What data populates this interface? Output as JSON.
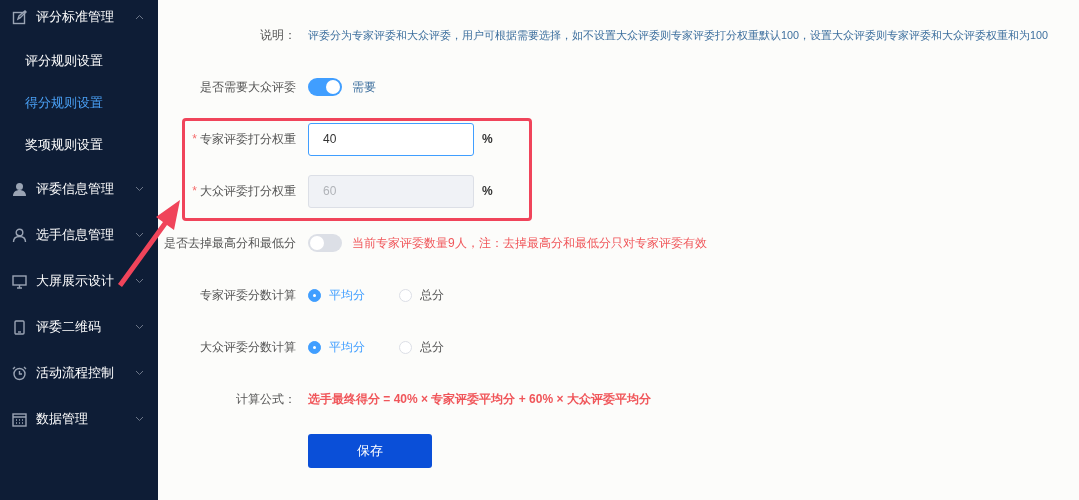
{
  "sidebar": {
    "items": [
      {
        "label": "评分标准管理",
        "expanded": true,
        "children": [
          {
            "label": "评分规则设置",
            "selected": false
          },
          {
            "label": "得分规则设置",
            "selected": true
          },
          {
            "label": "奖项规则设置",
            "selected": false
          }
        ]
      },
      {
        "label": "评委信息管理",
        "expanded": false
      },
      {
        "label": "选手信息管理",
        "expanded": false
      },
      {
        "label": "大屏展示设计",
        "expanded": false
      },
      {
        "label": "评委二维码",
        "expanded": false
      },
      {
        "label": "活动流程控制",
        "expanded": false
      },
      {
        "label": "数据管理",
        "expanded": false
      }
    ]
  },
  "form": {
    "rows": [
      {
        "kind": "note",
        "label": "说明：",
        "text": "评委分为专家评委和大众评委，用户可根据需要选择，如不设置大众评委则专家评委打分权重默认100，设置大众评委则专家评委和大众评委权重和为100"
      },
      {
        "kind": "switch",
        "label": "是否需要大众评委",
        "on": true,
        "text": "需要",
        "warning": false
      },
      {
        "kind": "input",
        "label": "专家评委打分权重",
        "required": true,
        "required_mark": "*",
        "value": "40",
        "disabled": false,
        "focused": true,
        "unit": "%"
      },
      {
        "kind": "input",
        "label": "大众评委打分权重",
        "required": true,
        "required_mark": "*",
        "value": "60",
        "disabled": true,
        "focused": false,
        "unit": "%"
      },
      {
        "kind": "switch",
        "label": "是否去掉最高分和最低分",
        "on": false,
        "text": "当前专家评委数量9人，注：去掉最高分和最低分只对专家评委有效",
        "warning": true
      },
      {
        "kind": "radio",
        "label": "专家评委分数计算",
        "options": [
          {
            "label": "平均分",
            "selected": true
          },
          {
            "label": "总分",
            "selected": false
          }
        ]
      },
      {
        "kind": "radio",
        "label": "大众评委分数计算",
        "options": [
          {
            "label": "平均分",
            "selected": true
          },
          {
            "label": "总分",
            "selected": false
          }
        ]
      },
      {
        "kind": "formula",
        "label": "计算公式：",
        "text": "选手最终得分 = 40% × 专家评委平均分 + 60% × 大众评委平均分"
      },
      {
        "kind": "button",
        "label": "保存"
      }
    ]
  }
}
